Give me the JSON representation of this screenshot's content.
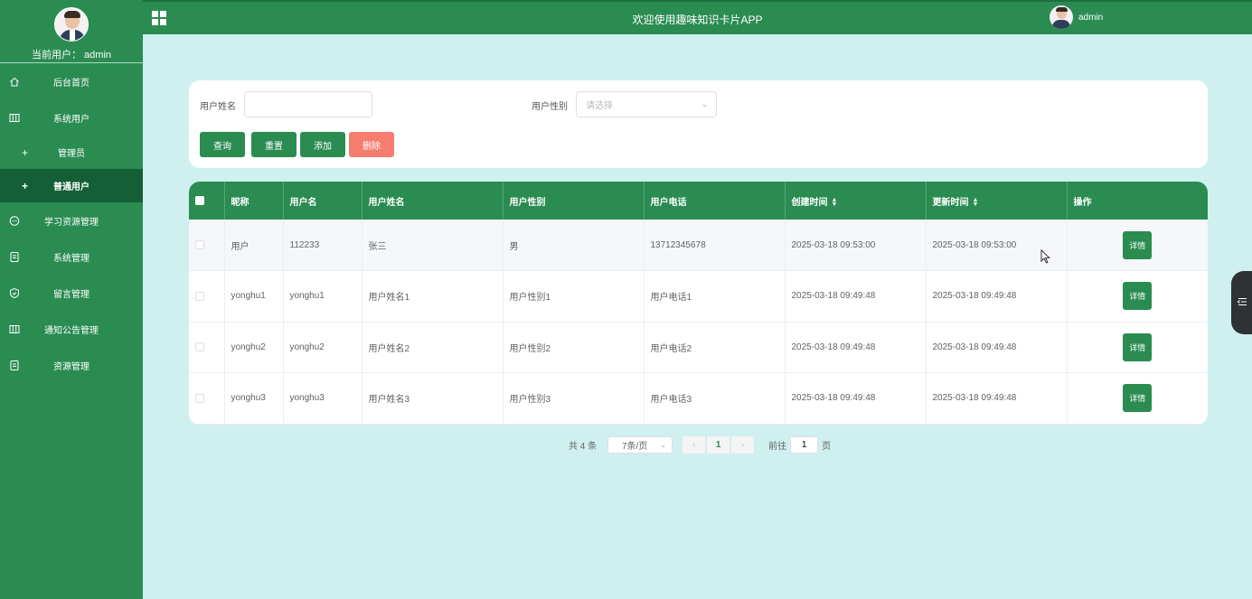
{
  "sidebar": {
    "current_user": "当前用户： admin",
    "items": [
      {
        "label": "后台首页",
        "icon": "home-icon"
      },
      {
        "label": "系统用户",
        "icon": "columns-icon"
      },
      {
        "label": "管理员",
        "icon": "plus-icon"
      },
      {
        "label": "普通用户",
        "icon": "plus-icon"
      },
      {
        "label": "学习资源管理",
        "icon": "chat-icon"
      },
      {
        "label": "系统管理",
        "icon": "document-icon"
      },
      {
        "label": "留言管理",
        "icon": "shield-icon"
      },
      {
        "label": "通知公告管理",
        "icon": "columns-icon"
      },
      {
        "label": "资源管理",
        "icon": "document-icon"
      }
    ],
    "active_index": 3
  },
  "header": {
    "title": "欢迎使用趣味知识卡片APP",
    "username": "admin"
  },
  "search": {
    "name_label": "用户姓名",
    "name_value": "",
    "gender_label": "用户性别",
    "gender_placeholder": "请选择",
    "buttons": {
      "query": "查询",
      "reset": "重置",
      "add": "添加",
      "delete": "删除"
    }
  },
  "table": {
    "headers": [
      "昵称",
      "用户名",
      "用户姓名",
      "用户性别",
      "用户电话",
      "创建时间",
      "更新时间",
      "操作"
    ],
    "rows": [
      {
        "nickname": "用户",
        "username": "112233",
        "realname": "张三",
        "gender": "男",
        "phone": "13712345678",
        "created": "2025-03-18 09:53:00",
        "updated": "2025-03-18 09:53:00",
        "action": "详情"
      },
      {
        "nickname": "yonghu1",
        "username": "yonghu1",
        "realname": "用户姓名1",
        "gender": "用户性别1",
        "phone": "用户电话1",
        "created": "2025-03-18 09:49:48",
        "updated": "2025-03-18 09:49:48",
        "action": "详情"
      },
      {
        "nickname": "yonghu2",
        "username": "yonghu2",
        "realname": "用户姓名2",
        "gender": "用户性别2",
        "phone": "用户电话2",
        "created": "2025-03-18 09:49:48",
        "updated": "2025-03-18 09:49:48",
        "action": "详情"
      },
      {
        "nickname": "yonghu3",
        "username": "yonghu3",
        "realname": "用户姓名3",
        "gender": "用户性别3",
        "phone": "用户电话3",
        "created": "2025-03-18 09:49:48",
        "updated": "2025-03-18 09:49:48",
        "action": "详情"
      }
    ]
  },
  "pagination": {
    "total": "共 4 条",
    "page_size": "7条/页",
    "current_page": "1",
    "goto_label": "前往",
    "goto_value": "1",
    "page_unit": "页"
  },
  "colors": {
    "primary": "#2a8c51",
    "active_menu": "#145f35",
    "background": "#cff0ee",
    "danger": "#f57e70"
  }
}
